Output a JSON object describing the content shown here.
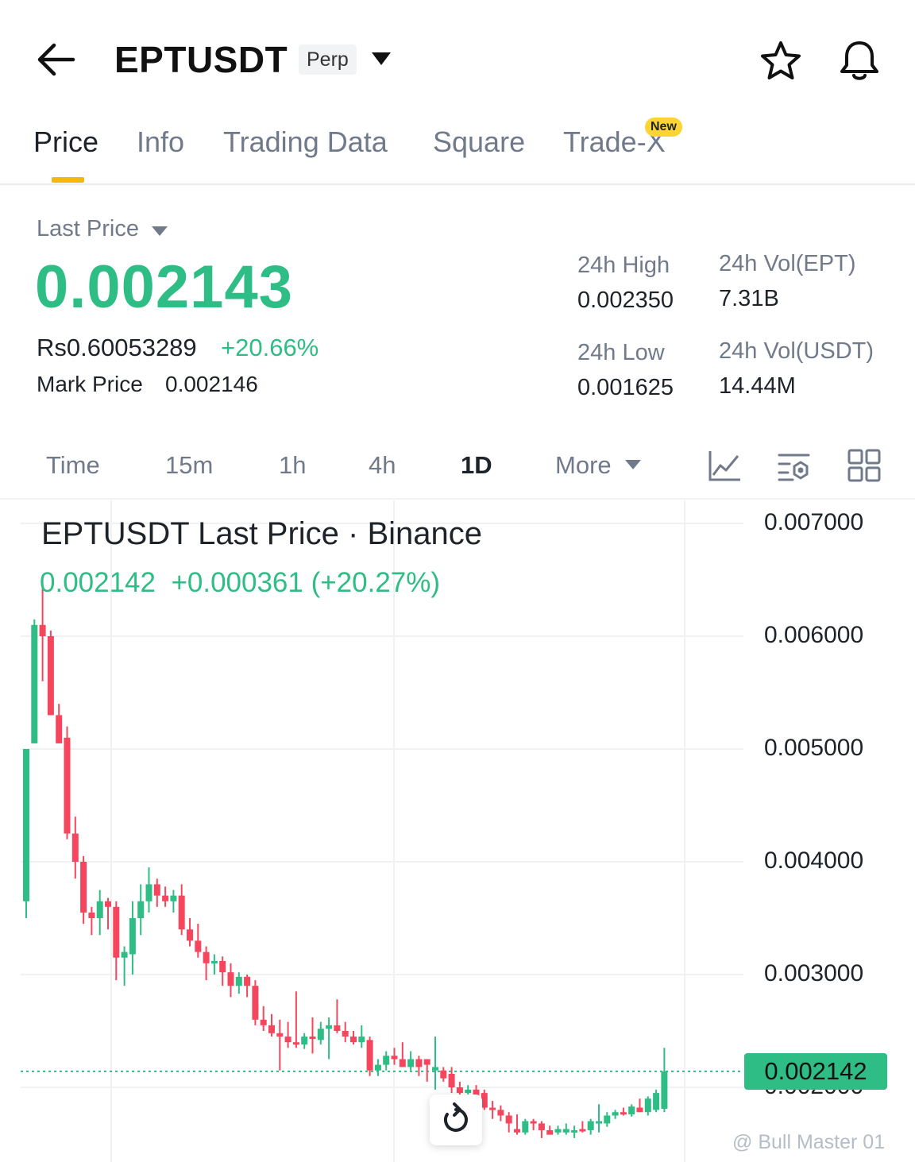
{
  "header": {
    "symbol": "EPTUSDT",
    "contract_type": "Perp"
  },
  "tabs": [
    {
      "label": "Price",
      "active": true
    },
    {
      "label": "Info",
      "active": false
    },
    {
      "label": "Trading Data",
      "active": false
    },
    {
      "label": "Square",
      "active": false
    },
    {
      "label": "Trade-X",
      "active": false,
      "badge": "New"
    }
  ],
  "price": {
    "label": "Last Price",
    "value": "0.002143",
    "fiat": "Rs0.60053289",
    "change_pct": "+20.66%",
    "mark_label": "Mark Price",
    "mark_value": "0.002146"
  },
  "stats": {
    "high_label": "24h High",
    "high_value": "0.002350",
    "low_label": "24h Low",
    "low_value": "0.001625",
    "vol_base_label": "24h Vol(EPT)",
    "vol_base_value": "7.31B",
    "vol_quote_label": "24h Vol(USDT)",
    "vol_quote_value": "14.44M"
  },
  "timeframes": [
    {
      "label": "Time",
      "active": false
    },
    {
      "label": "15m",
      "active": false
    },
    {
      "label": "1h",
      "active": false
    },
    {
      "label": "4h",
      "active": false
    },
    {
      "label": "1D",
      "active": true
    },
    {
      "label": "More",
      "active": false
    }
  ],
  "chart": {
    "title": "EPTUSDT Last Price · Binance",
    "quote_price": "0.002142",
    "quote_change": "+0.000361 (+20.27%)",
    "current_price_tag": "0.002142",
    "y_axis_labels": [
      "0.007000",
      "0.006000",
      "0.005000",
      "0.004000",
      "0.003000",
      "0.002000"
    ]
  },
  "colors": {
    "up": "#2ebd85",
    "down": "#f6465d",
    "accent": "#f0b90b"
  },
  "icons": {
    "back": "arrow-left-icon",
    "dropdown": "caret-down-icon",
    "favorite": "star-icon",
    "alert": "bell-icon",
    "indicator": "line-chart-icon",
    "settings": "chart-settings-icon",
    "layout": "grid-icon",
    "reset": "refresh-icon"
  },
  "watermark": "@ Bull Master 01",
  "chart_data": {
    "type": "candlestick",
    "y_range": [
      0.0016,
      0.0075
    ],
    "candles": [
      {
        "o": 0.00365,
        "h": 0.0042,
        "l": 0.0035,
        "c": 0.005,
        "dir": "up"
      },
      {
        "o": 0.00505,
        "h": 0.00615,
        "l": 0.00505,
        "c": 0.0061,
        "dir": "up"
      },
      {
        "o": 0.0061,
        "h": 0.0065,
        "l": 0.0056,
        "c": 0.006,
        "dir": "down"
      },
      {
        "o": 0.006,
        "h": 0.00605,
        "l": 0.0053,
        "c": 0.0053,
        "dir": "down"
      },
      {
        "o": 0.0053,
        "h": 0.0054,
        "l": 0.00505,
        "c": 0.00505,
        "dir": "down"
      },
      {
        "o": 0.0051,
        "h": 0.0052,
        "l": 0.0042,
        "c": 0.00425,
        "dir": "down"
      },
      {
        "o": 0.00425,
        "h": 0.0044,
        "l": 0.00385,
        "c": 0.004,
        "dir": "down"
      },
      {
        "o": 0.004,
        "h": 0.00405,
        "l": 0.00345,
        "c": 0.00355,
        "dir": "down"
      },
      {
        "o": 0.00355,
        "h": 0.0036,
        "l": 0.00335,
        "c": 0.0035,
        "dir": "down"
      },
      {
        "o": 0.0035,
        "h": 0.00375,
        "l": 0.00335,
        "c": 0.00365,
        "dir": "up"
      },
      {
        "o": 0.00365,
        "h": 0.00368,
        "l": 0.0034,
        "c": 0.0036,
        "dir": "down"
      },
      {
        "o": 0.0036,
        "h": 0.00365,
        "l": 0.00295,
        "c": 0.00315,
        "dir": "down"
      },
      {
        "o": 0.00315,
        "h": 0.00325,
        "l": 0.0029,
        "c": 0.0032,
        "dir": "up"
      },
      {
        "o": 0.00318,
        "h": 0.00365,
        "l": 0.003,
        "c": 0.0035,
        "dir": "up"
      },
      {
        "o": 0.0035,
        "h": 0.0038,
        "l": 0.00335,
        "c": 0.00365,
        "dir": "up"
      },
      {
        "o": 0.00365,
        "h": 0.00395,
        "l": 0.00355,
        "c": 0.0038,
        "dir": "up"
      },
      {
        "o": 0.0038,
        "h": 0.00385,
        "l": 0.0036,
        "c": 0.0037,
        "dir": "down"
      },
      {
        "o": 0.0037,
        "h": 0.00378,
        "l": 0.0036,
        "c": 0.00365,
        "dir": "down"
      },
      {
        "o": 0.00365,
        "h": 0.00375,
        "l": 0.00355,
        "c": 0.0037,
        "dir": "up"
      },
      {
        "o": 0.0037,
        "h": 0.0038,
        "l": 0.00335,
        "c": 0.0034,
        "dir": "down"
      },
      {
        "o": 0.0034,
        "h": 0.0035,
        "l": 0.00325,
        "c": 0.0033,
        "dir": "down"
      },
      {
        "o": 0.0033,
        "h": 0.00345,
        "l": 0.00315,
        "c": 0.0032,
        "dir": "down"
      },
      {
        "o": 0.0032,
        "h": 0.00325,
        "l": 0.00295,
        "c": 0.0031,
        "dir": "down"
      },
      {
        "o": 0.0031,
        "h": 0.00318,
        "l": 0.003,
        "c": 0.00312,
        "dir": "up"
      },
      {
        "o": 0.00312,
        "h": 0.00316,
        "l": 0.0029,
        "c": 0.00302,
        "dir": "down"
      },
      {
        "o": 0.00302,
        "h": 0.0031,
        "l": 0.0028,
        "c": 0.0029,
        "dir": "down"
      },
      {
        "o": 0.0029,
        "h": 0.00302,
        "l": 0.00283,
        "c": 0.00298,
        "dir": "up"
      },
      {
        "o": 0.00298,
        "h": 0.003,
        "l": 0.0028,
        "c": 0.0029,
        "dir": "down"
      },
      {
        "o": 0.0029,
        "h": 0.00295,
        "l": 0.00255,
        "c": 0.0026,
        "dir": "down"
      },
      {
        "o": 0.0026,
        "h": 0.00272,
        "l": 0.0025,
        "c": 0.00255,
        "dir": "down"
      },
      {
        "o": 0.00255,
        "h": 0.00265,
        "l": 0.00245,
        "c": 0.00248,
        "dir": "down"
      },
      {
        "o": 0.00248,
        "h": 0.0026,
        "l": 0.00215,
        "c": 0.00245,
        "dir": "down"
      },
      {
        "o": 0.00245,
        "h": 0.00258,
        "l": 0.00235,
        "c": 0.0024,
        "dir": "down"
      },
      {
        "o": 0.0024,
        "h": 0.00285,
        "l": 0.00235,
        "c": 0.00238,
        "dir": "down"
      },
      {
        "o": 0.00238,
        "h": 0.00248,
        "l": 0.00234,
        "c": 0.00245,
        "dir": "up"
      },
      {
        "o": 0.00245,
        "h": 0.00262,
        "l": 0.0023,
        "c": 0.00245,
        "dir": "down"
      },
      {
        "o": 0.00242,
        "h": 0.00258,
        "l": 0.00238,
        "c": 0.00252,
        "dir": "up"
      },
      {
        "o": 0.00252,
        "h": 0.00262,
        "l": 0.00225,
        "c": 0.00255,
        "dir": "up"
      },
      {
        "o": 0.00255,
        "h": 0.00278,
        "l": 0.00248,
        "c": 0.0025,
        "dir": "down"
      },
      {
        "o": 0.0025,
        "h": 0.00258,
        "l": 0.0024,
        "c": 0.00245,
        "dir": "down"
      },
      {
        "o": 0.00245,
        "h": 0.0025,
        "l": 0.00238,
        "c": 0.0024,
        "dir": "down"
      },
      {
        "o": 0.0024,
        "h": 0.00255,
        "l": 0.00235,
        "c": 0.00245,
        "dir": "up"
      },
      {
        "o": 0.00242,
        "h": 0.00245,
        "l": 0.0021,
        "c": 0.00215,
        "dir": "down"
      },
      {
        "o": 0.00215,
        "h": 0.00225,
        "l": 0.0021,
        "c": 0.0022,
        "dir": "up"
      },
      {
        "o": 0.0022,
        "h": 0.00232,
        "l": 0.00215,
        "c": 0.00228,
        "dir": "up"
      },
      {
        "o": 0.00228,
        "h": 0.00235,
        "l": 0.0022,
        "c": 0.00225,
        "dir": "down"
      },
      {
        "o": 0.00225,
        "h": 0.0024,
        "l": 0.00218,
        "c": 0.00218,
        "dir": "down"
      },
      {
        "o": 0.00218,
        "h": 0.00232,
        "l": 0.00215,
        "c": 0.00225,
        "dir": "up"
      },
      {
        "o": 0.00225,
        "h": 0.00228,
        "l": 0.0021,
        "c": 0.00218,
        "dir": "down"
      },
      {
        "o": 0.0022,
        "h": 0.00225,
        "l": 0.00205,
        "c": 0.00225,
        "dir": "down"
      },
      {
        "o": 0.00218,
        "h": 0.00245,
        "l": 0.00198,
        "c": 0.00215,
        "dir": "up"
      },
      {
        "o": 0.00215,
        "h": 0.00218,
        "l": 0.00205,
        "c": 0.00208,
        "dir": "down"
      },
      {
        "o": 0.00212,
        "h": 0.00218,
        "l": 0.00195,
        "c": 0.002,
        "dir": "down"
      },
      {
        "o": 0.002,
        "h": 0.00205,
        "l": 0.00192,
        "c": 0.00195,
        "dir": "down"
      },
      {
        "o": 0.00195,
        "h": 0.00202,
        "l": 0.00188,
        "c": 0.00198,
        "dir": "up"
      },
      {
        "o": 0.00198,
        "h": 0.00202,
        "l": 0.0019,
        "c": 0.00192,
        "dir": "down"
      },
      {
        "o": 0.00195,
        "h": 0.00198,
        "l": 0.0018,
        "c": 0.00182,
        "dir": "down"
      },
      {
        "o": 0.00182,
        "h": 0.00188,
        "l": 0.00172,
        "c": 0.0018,
        "dir": "down"
      },
      {
        "o": 0.0018,
        "h": 0.00184,
        "l": 0.0017,
        "c": 0.00175,
        "dir": "down"
      },
      {
        "o": 0.00175,
        "h": 0.00178,
        "l": 0.0016,
        "c": 0.00168,
        "dir": "down"
      },
      {
        "o": 0.00163,
        "h": 0.00176,
        "l": 0.00158,
        "c": 0.0016,
        "dir": "down"
      },
      {
        "o": 0.0016,
        "h": 0.00172,
        "l": 0.00158,
        "c": 0.0017,
        "dir": "up"
      },
      {
        "o": 0.00168,
        "h": 0.00172,
        "l": 0.00162,
        "c": 0.0017,
        "dir": "down"
      },
      {
        "o": 0.00168,
        "h": 0.0017,
        "l": 0.00155,
        "c": 0.00162,
        "dir": "down"
      },
      {
        "o": 0.00162,
        "h": 0.00166,
        "l": 0.0016,
        "c": 0.00158,
        "dir": "down"
      },
      {
        "o": 0.0016,
        "h": 0.00166,
        "l": 0.00158,
        "c": 0.00163,
        "dir": "up"
      },
      {
        "o": 0.00163,
        "h": 0.00168,
        "l": 0.00158,
        "c": 0.0016,
        "dir": "up"
      },
      {
        "o": 0.00162,
        "h": 0.00166,
        "l": 0.00155,
        "c": 0.00162,
        "dir": "up"
      },
      {
        "o": 0.00163,
        "h": 0.0017,
        "l": 0.0016,
        "c": 0.00162,
        "dir": "down"
      },
      {
        "o": 0.00162,
        "h": 0.00172,
        "l": 0.00158,
        "c": 0.0017,
        "dir": "up"
      },
      {
        "o": 0.0017,
        "h": 0.00185,
        "l": 0.0016,
        "c": 0.00168,
        "dir": "up"
      },
      {
        "o": 0.00168,
        "h": 0.00178,
        "l": 0.00165,
        "c": 0.00175,
        "dir": "up"
      },
      {
        "o": 0.00175,
        "h": 0.0018,
        "l": 0.00172,
        "c": 0.00178,
        "dir": "up"
      },
      {
        "o": 0.00178,
        "h": 0.00182,
        "l": 0.00175,
        "c": 0.00176,
        "dir": "down"
      },
      {
        "o": 0.00176,
        "h": 0.00185,
        "l": 0.00174,
        "c": 0.00183,
        "dir": "up"
      },
      {
        "o": 0.00182,
        "h": 0.0019,
        "l": 0.00178,
        "c": 0.00178,
        "dir": "down"
      },
      {
        "o": 0.00178,
        "h": 0.00192,
        "l": 0.00175,
        "c": 0.0019,
        "dir": "up"
      },
      {
        "o": 0.0018,
        "h": 0.00198,
        "l": 0.00178,
        "c": 0.00195,
        "dir": "up"
      },
      {
        "o": 0.00181,
        "h": 0.00235,
        "l": 0.00178,
        "c": 0.00214,
        "dir": "up"
      }
    ]
  }
}
